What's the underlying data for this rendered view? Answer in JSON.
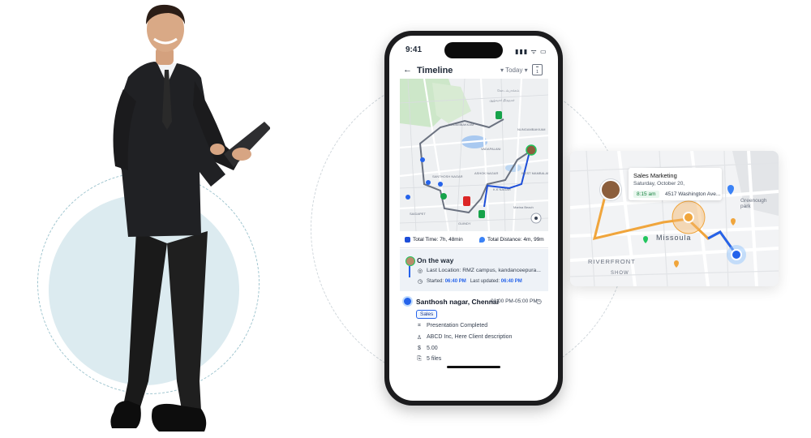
{
  "phone": {
    "status_time": "9:41",
    "status_icons": "▮▮▮ ᯤ ▭",
    "back_icon": "←",
    "title": "Timeline",
    "date_select": "Today",
    "calendar_icon": "calendar-icon",
    "map_labels": [
      "கோடம்பாக்கம்",
      "ஆழ்வார் திருநகர்",
      "KODAMBAKKAM",
      "NUNGAMBAKKAM",
      "VADAPALANI",
      "SANTHOSH NAGAR",
      "ASHOK NAGAR",
      "WEST MAMBALAM",
      "K.K NAGAR",
      "SAIDAPET",
      "GUINDY",
      "Marina Beach"
    ],
    "stats": {
      "total_time_label": "Total Time: 7h, 48min",
      "total_distance_label": "Total Distance: 4m, 99m"
    },
    "on_the_way": {
      "title": "On the way",
      "location_label": "Last Location: RMZ campus, kandanceepura...",
      "started_label": "Started:",
      "started_time": "06:40 PM",
      "updated_label": "Last updated:",
      "updated_time": "06:40 PM"
    },
    "visit": {
      "title": "Santhosh nagar, Chennai",
      "time_range": "03:00 PM-05:00 PM",
      "tag": "Sales",
      "rows": [
        {
          "icon": "task-icon",
          "glyph": "⌗",
          "text": "Presentation Completed"
        },
        {
          "icon": "client-icon",
          "glyph": "♙",
          "text": "ABCD Inc, Here Client description"
        },
        {
          "icon": "dollar-icon",
          "glyph": "$",
          "text": "5.00"
        },
        {
          "icon": "attachment-icon",
          "glyph": "⎘",
          "text": "5 files"
        }
      ]
    }
  },
  "map_card": {
    "popup_title": "Sales Marketing",
    "popup_date": "Saturday, October 20,",
    "popup_time": "8:15 am",
    "popup_address": "4517 Washington Ave...",
    "labels": {
      "missoula": "Missoula",
      "riverfront": "RIVERFRONT",
      "greenough": "Greenough park",
      "lower": "SHOW"
    }
  },
  "colors": {
    "accent": "#2563eb",
    "route_blue": "#1d4ed8",
    "route_orange": "#f0a53c",
    "circle_bg": "#dcebf0"
  }
}
